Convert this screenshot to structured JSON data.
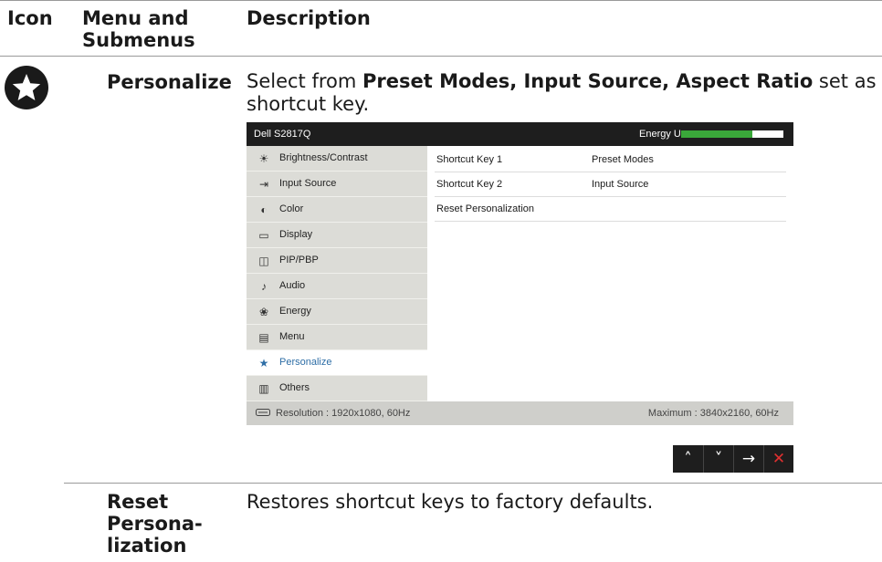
{
  "table": {
    "headers": {
      "icon": "Icon",
      "menu": "Menu and Submenus",
      "description": "Description"
    },
    "rows": [
      {
        "menu": "Personalize",
        "icon": "star-circle-icon",
        "description": {
          "prefix": "Select from ",
          "bold": "Preset Modes, Input Source, Aspect Ratio",
          "suffix": " set as shortcut key."
        }
      },
      {
        "menu": "Reset Persona- lization",
        "description": "Restores shortcut keys to factory defaults."
      }
    ]
  },
  "osd": {
    "model": "Dell S2817Q",
    "energy_label": "Energy Use",
    "energy_level": 0.7,
    "energy_color": "#3aa83a",
    "menu_items": [
      {
        "label": "Brightness/Contrast",
        "icon": "brightness-icon",
        "selected": false
      },
      {
        "label": "Input Source",
        "icon": "input-source-icon",
        "selected": false
      },
      {
        "label": "Color",
        "icon": "color-icon",
        "selected": false
      },
      {
        "label": "Display",
        "icon": "display-icon",
        "selected": false
      },
      {
        "label": "PIP/PBP",
        "icon": "pip-pbp-icon",
        "selected": false
      },
      {
        "label": "Audio",
        "icon": "audio-icon",
        "selected": false
      },
      {
        "label": "Energy",
        "icon": "energy-icon",
        "selected": false
      },
      {
        "label": "Menu",
        "icon": "menu-icon",
        "selected": false
      },
      {
        "label": "Personalize",
        "icon": "star-icon",
        "selected": true
      },
      {
        "label": "Others",
        "icon": "others-icon",
        "selected": false
      }
    ],
    "panel_rows": [
      {
        "key": "Shortcut Key 1",
        "value": "Preset Modes"
      },
      {
        "key": "Shortcut Key 2",
        "value": "Input Source"
      },
      {
        "key": "Reset Personalization",
        "value": ""
      }
    ],
    "footer": {
      "resolution": "Resolution : 1920x1080, 60Hz",
      "maximum": "Maximum : 3840x2160, 60Hz"
    },
    "nav_buttons": [
      "up-icon",
      "down-icon",
      "right-arrow-icon",
      "close-icon"
    ],
    "selected_color": "#2e6ea6"
  }
}
